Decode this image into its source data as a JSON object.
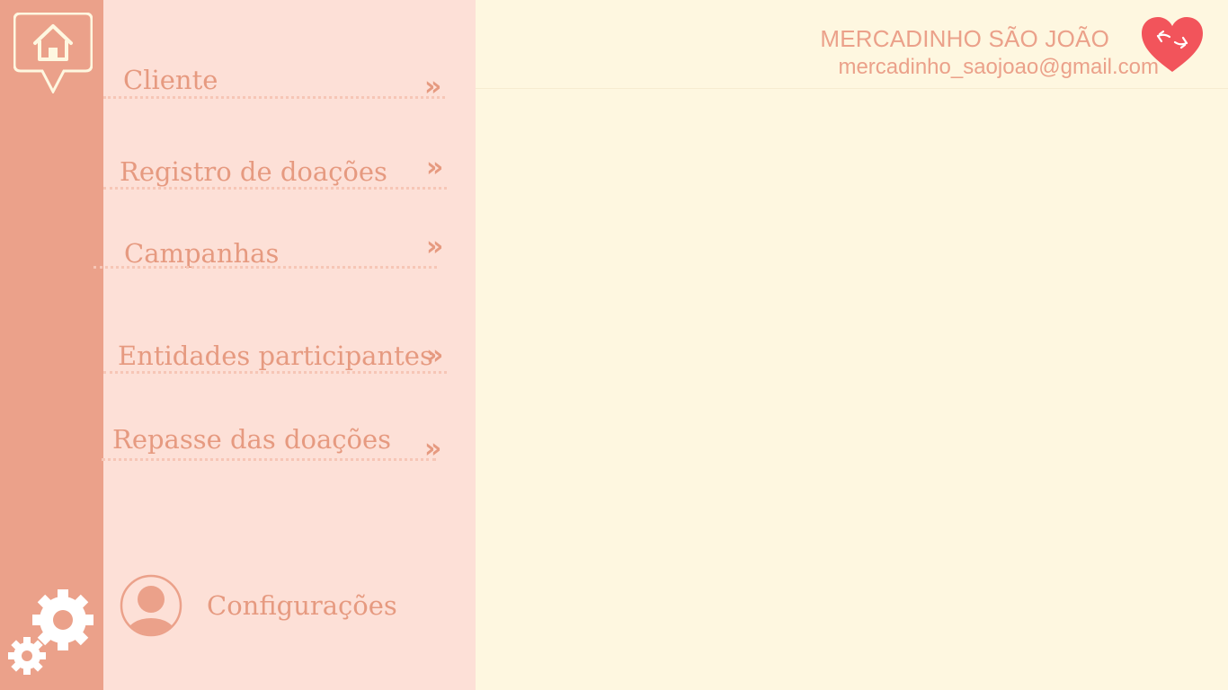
{
  "rail": {
    "home_icon": "home-icon",
    "settings_icon": "gears-icon"
  },
  "menu": {
    "items": [
      {
        "label": "Cliente",
        "arrow": "»"
      },
      {
        "label": "Registro de doações",
        "arrow": "»"
      },
      {
        "label": "Campanhas",
        "arrow": "»"
      },
      {
        "label": "Entidades participantes",
        "arrow": "»"
      },
      {
        "label": "Repasse das doações",
        "arrow": "»"
      }
    ],
    "settings_label": "Configurações",
    "profile_icon": "user-avatar-icon"
  },
  "header": {
    "store_name": "MERCADINHO SÃO JOÃO",
    "email": "mercadinho_saojoao@gmail.com",
    "logo_icon": "heart-hands-icon"
  },
  "colors": {
    "rail": "#eba18a",
    "menu_panel": "#fde0d7",
    "content": "#fef7e0",
    "accent_text": "#e69a80",
    "logo_heart": "#f2545b"
  }
}
